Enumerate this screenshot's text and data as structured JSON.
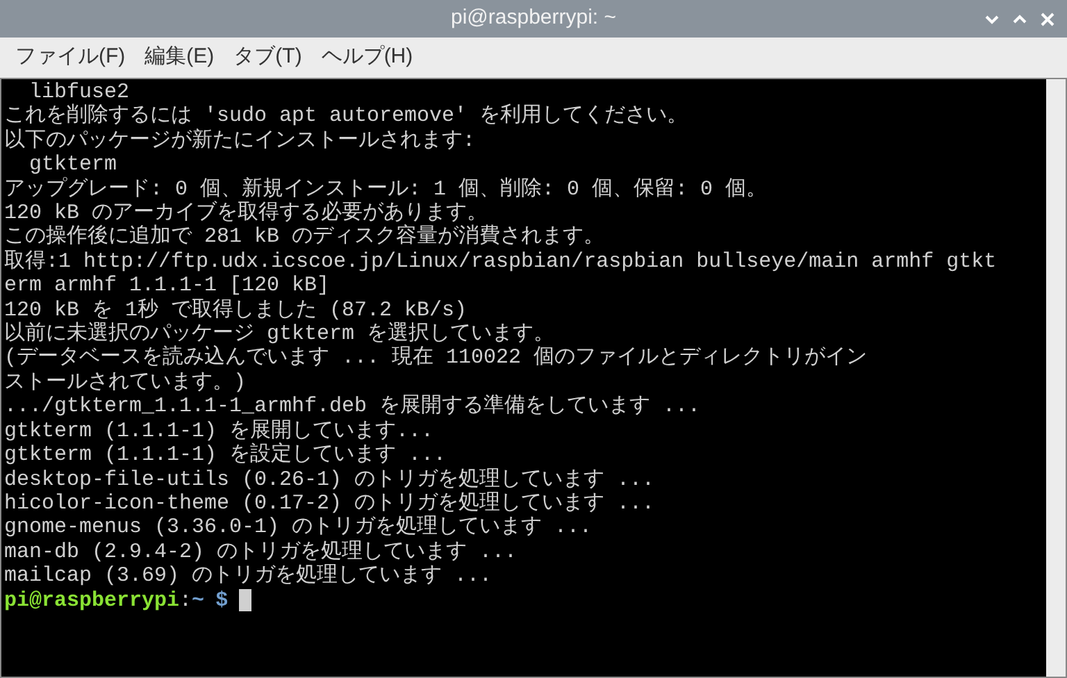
{
  "window": {
    "title": "pi@raspberrypi: ~"
  },
  "menu": [
    "ファイル(F)",
    "編集(E)",
    "タブ(T)",
    "ヘルプ(H)"
  ],
  "terminal": {
    "lines": [
      "  libfuse2",
      "これを削除するには 'sudo apt autoremove' を利用してください。",
      "以下のパッケージが新たにインストールされます:",
      "  gtkterm",
      "アップグレード: 0 個、新規インストール: 1 個、削除: 0 個、保留: 0 個。",
      "120 kB のアーカイブを取得する必要があります。",
      "この操作後に追加で 281 kB のディスク容量が消費されます。",
      "取得:1 http://ftp.udx.icscoe.jp/Linux/raspbian/raspbian bullseye/main armhf gtkt",
      "erm armhf 1.1.1-1 [120 kB]",
      "120 kB を 1秒 で取得しました (87.2 kB/s)",
      "以前に未選択のパッケージ gtkterm を選択しています。",
      "(データベースを読み込んでいます ... 現在 110022 個のファイルとディレクトリがイン",
      "ストールされています。)",
      ".../gtkterm_1.1.1-1_armhf.deb を展開する準備をしています ...",
      "gtkterm (1.1.1-1) を展開しています...",
      "gtkterm (1.1.1-1) を設定しています ...",
      "desktop-file-utils (0.26-1) のトリガを処理しています ...",
      "hicolor-icon-theme (0.17-2) のトリガを処理しています ...",
      "gnome-menus (3.36.0-1) のトリガを処理しています ...",
      "man-db (2.9.4-2) のトリガを処理しています ...",
      "mailcap (3.69) のトリガを処理しています ..."
    ],
    "prompt": {
      "user_host": "pi@raspberrypi",
      "separator": ":",
      "path": "~",
      "symbol": "$"
    }
  }
}
